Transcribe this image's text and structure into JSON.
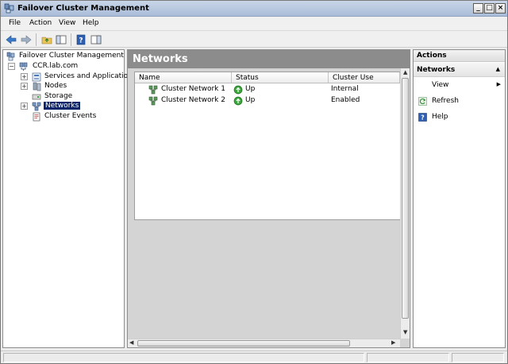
{
  "window": {
    "title": "Failover Cluster Management"
  },
  "menu": [
    "File",
    "Action",
    "View",
    "Help"
  ],
  "tree": {
    "root": "Failover Cluster Management",
    "cluster": "CCR.lab.com",
    "items": [
      "Services and Applications",
      "Nodes",
      "Storage",
      "Networks",
      "Cluster Events"
    ]
  },
  "center": {
    "title": "Networks",
    "columns": [
      "Name",
      "Status",
      "Cluster Use"
    ],
    "rows": [
      {
        "name": "Cluster Network 1",
        "status": "Up",
        "use": "Internal"
      },
      {
        "name": "Cluster Network 2",
        "status": "Up",
        "use": "Enabled"
      }
    ]
  },
  "actions": {
    "header": "Actions",
    "section": "Networks",
    "items": [
      "View",
      "Refresh",
      "Help"
    ]
  },
  "colors": {
    "selection": "#0a246a",
    "header_bg": "#8c8c8c",
    "status_up": "#2f9a2f"
  }
}
